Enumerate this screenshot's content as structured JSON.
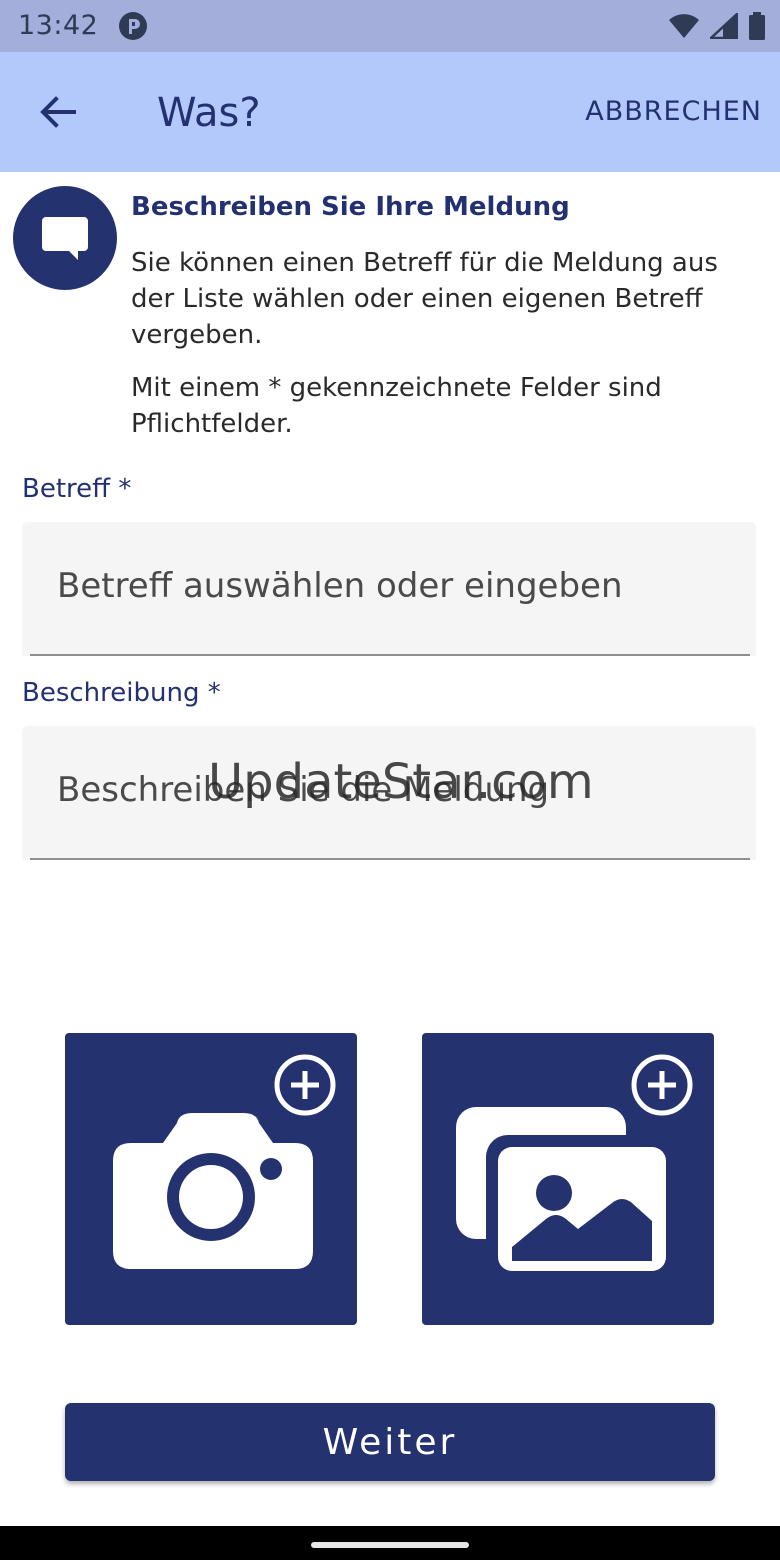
{
  "status_bar": {
    "time": "13:42",
    "app_icon": "app-notification-icon",
    "icons": [
      "wifi-icon",
      "signal-icon",
      "battery-icon"
    ]
  },
  "app_bar": {
    "back_icon": "arrow-left-icon",
    "title": "Was?",
    "cancel_label": "ABBRECHEN"
  },
  "info": {
    "icon": "chat-bubble-icon",
    "heading": "Beschreiben Sie Ihre Meldung",
    "text1": "Sie können einen Betreff für die Meldung aus der Liste wählen oder einen eigenen Betreff vergeben.",
    "text2": "Mit einem * gekennzeichnete Felder sind Pflichtfelder."
  },
  "form": {
    "subject_label": "Betreff *",
    "subject_placeholder": "Betreff auswählen oder eingeben",
    "subject_value": "",
    "description_label": "Beschreibung *",
    "description_placeholder": "Beschreiben Sie die Meldung",
    "description_value": ""
  },
  "watermark": "UpdateStar.com",
  "media": {
    "camera_icon": "camera-icon",
    "gallery_icon": "gallery-icon",
    "add_icon": "plus-circle-icon"
  },
  "next_label": "Weiter",
  "colors": {
    "primary": "#24326f",
    "app_bar": "#b3c9fb",
    "status_bar": "#a3aedb",
    "field_bg": "#f5f5f5"
  }
}
